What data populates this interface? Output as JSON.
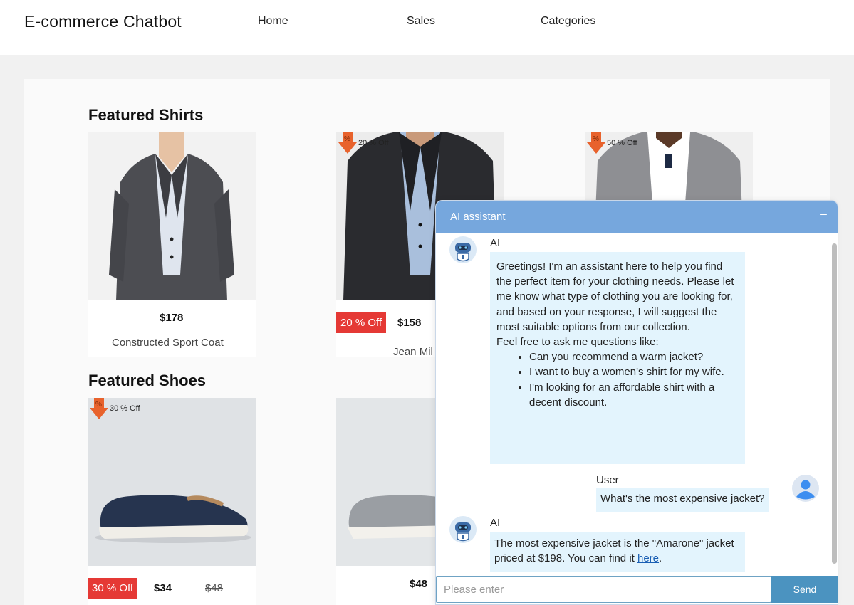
{
  "header": {
    "brand": "E-commerce Chatbot",
    "nav": [
      "Home",
      "Sales",
      "Categories"
    ]
  },
  "shirts": {
    "title": "Featured Shirts",
    "items": [
      {
        "price": "$178",
        "name": "Constructed Sport Coat"
      },
      {
        "discount": "20 % Off",
        "ribbon": "20 % Off",
        "price": "$158",
        "name": "Jean Mil"
      },
      {
        "ribbon": "50 % Off"
      }
    ]
  },
  "shoes": {
    "title": "Featured Shoes",
    "items": [
      {
        "ribbon": "30 % Off",
        "discount": "30 % Off",
        "price": "$34",
        "old_price": "$48"
      },
      {
        "price": "$48"
      }
    ]
  },
  "chat": {
    "title": "AI assistant",
    "minimize": "−",
    "messages": [
      {
        "sender": "AI",
        "intro": "Greetings! I'm an assistant here to help you find the perfect item for your clothing needs. Please let me know what type of clothing you are looking for, and based on your response, I will suggest the most suitable options from our collection.",
        "prompt": "Feel free to ask me questions like:",
        "examples": [
          "Can you recommend a warm jacket?",
          "I want to buy a women's shirt for my wife.",
          "I'm looking for an affordable shirt with a decent discount."
        ]
      },
      {
        "sender": "User",
        "text": "What's the most expensive jacket?"
      },
      {
        "sender": "AI",
        "text": "The most expensive jacket is the \"Amarone\" jacket priced at $198. You can find it",
        "link": "here",
        "after": "."
      }
    ],
    "input_placeholder": "Please enter",
    "send": "Send"
  },
  "colors": {
    "header_bar": "#76a7dd",
    "bubble": "#e3f4fd",
    "discount": "#e53935",
    "send": "#4b93c0"
  },
  "icons": [
    "robot-avatar-icon",
    "user-avatar-icon",
    "discount-arrow-icon",
    "minimize-icon"
  ]
}
